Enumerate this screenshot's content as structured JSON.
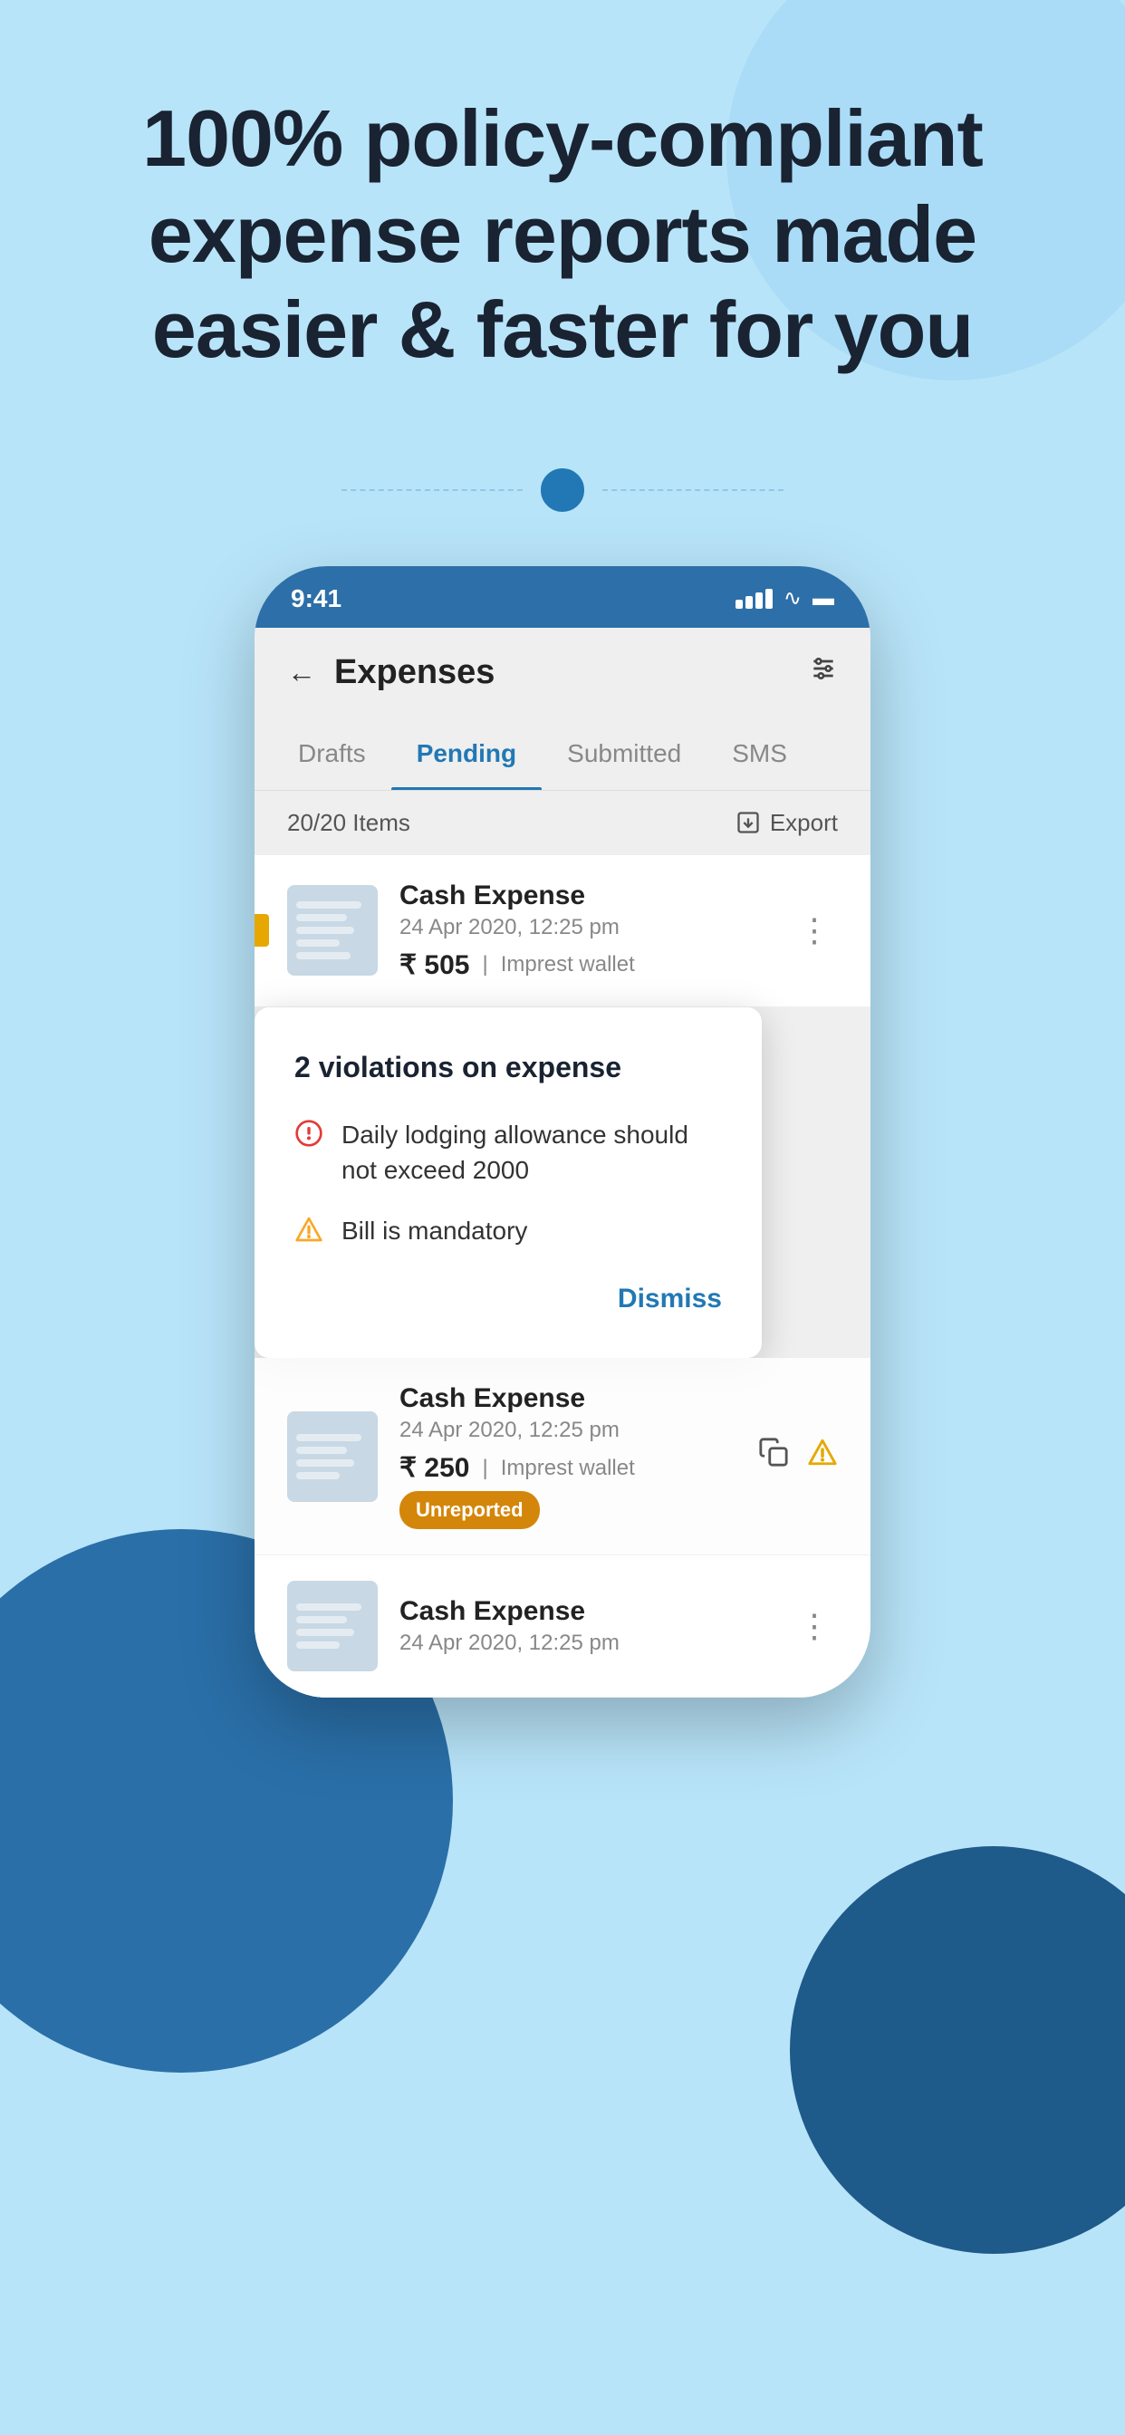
{
  "hero": {
    "title": "100% policy-compliant expense reports made easier & faster for you"
  },
  "pagination": {
    "active_dot": 1
  },
  "phone": {
    "status_bar": {
      "time": "9:41"
    },
    "header": {
      "title": "Expenses",
      "back_label": "←",
      "filter_label": "⊞"
    },
    "tabs": [
      {
        "label": "Drafts",
        "active": false
      },
      {
        "label": "Pending",
        "active": true
      },
      {
        "label": "Submitted",
        "active": false
      },
      {
        "label": "SMS",
        "active": false
      }
    ],
    "items_bar": {
      "count": "20/20 Items",
      "export_label": "Export"
    },
    "expense_items": [
      {
        "name": "Cash Expense",
        "date": "24 Apr 2020, 12:25 pm",
        "amount": "₹ 505",
        "wallet": "Imprest wallet",
        "has_violation_dot": true
      },
      {
        "name": "Cash Expense",
        "date": "24 Apr 2020, 12:25 pm",
        "amount": "₹ 250",
        "wallet": "Imprest wallet",
        "badge": "Unreported",
        "has_icons": true
      },
      {
        "name": "Cash Expense",
        "date": "24 Apr 2020, 12:25 pm",
        "amount": "",
        "wallet": "",
        "badge": null
      }
    ],
    "dialog": {
      "title": "2 violations on expense",
      "violations": [
        {
          "icon": "error",
          "text": "Daily lodging allowance should not exceed 2000",
          "icon_color": "#e53935"
        },
        {
          "icon": "warning",
          "text": "Bill is mandatory",
          "icon_color": "#f9a825"
        }
      ],
      "dismiss_label": "Dismiss"
    }
  }
}
